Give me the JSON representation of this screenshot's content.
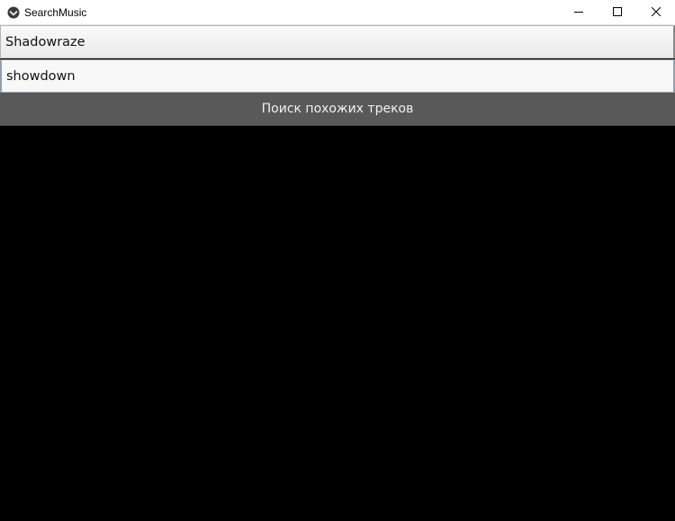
{
  "window": {
    "title": "SearchMusic",
    "icon": "kivy-app-icon",
    "controls": {
      "minimize": "minimize-icon",
      "maximize": "maximize-icon",
      "close": "close-icon"
    }
  },
  "form": {
    "artist_value": "Shadowraze",
    "track_value": "showdown",
    "search_button_label": "Поиск похожих треков"
  },
  "colors": {
    "background": "#000000",
    "button": "#595959",
    "button_text": "#f0f0f0",
    "field": "#f5f5f5"
  }
}
